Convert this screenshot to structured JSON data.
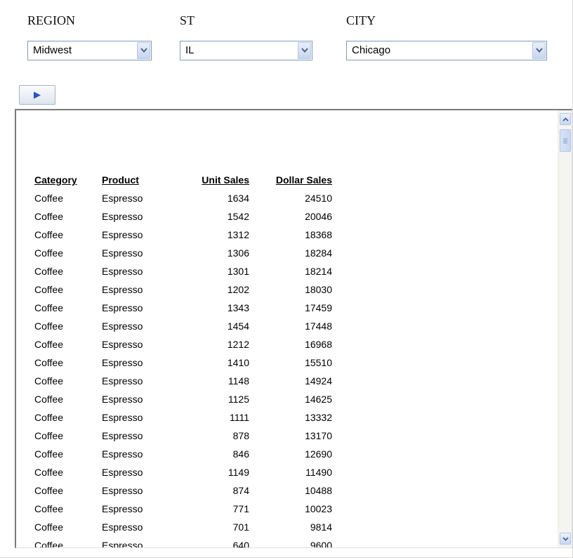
{
  "filters": {
    "region": {
      "label": "REGION",
      "value": "Midwest"
    },
    "state": {
      "label": "ST",
      "value": "IL"
    },
    "city": {
      "label": "CITY",
      "value": "Chicago"
    }
  },
  "run_button": {
    "icon": "play-icon"
  },
  "report": {
    "headers": {
      "category": "Category",
      "product": "Product",
      "unit_sales": "Unit Sales",
      "dollar_sales": "Dollar Sales"
    },
    "rows": [
      {
        "category": "Coffee",
        "product": "Espresso",
        "unit_sales": "1634",
        "dollar_sales": "24510"
      },
      {
        "category": "Coffee",
        "product": "Espresso",
        "unit_sales": "1542",
        "dollar_sales": "20046"
      },
      {
        "category": "Coffee",
        "product": "Espresso",
        "unit_sales": "1312",
        "dollar_sales": "18368"
      },
      {
        "category": "Coffee",
        "product": "Espresso",
        "unit_sales": "1306",
        "dollar_sales": "18284"
      },
      {
        "category": "Coffee",
        "product": "Espresso",
        "unit_sales": "1301",
        "dollar_sales": "18214"
      },
      {
        "category": "Coffee",
        "product": "Espresso",
        "unit_sales": "1202",
        "dollar_sales": "18030"
      },
      {
        "category": "Coffee",
        "product": "Espresso",
        "unit_sales": "1343",
        "dollar_sales": "17459"
      },
      {
        "category": "Coffee",
        "product": "Espresso",
        "unit_sales": "1454",
        "dollar_sales": "17448"
      },
      {
        "category": "Coffee",
        "product": "Espresso",
        "unit_sales": "1212",
        "dollar_sales": "16968"
      },
      {
        "category": "Coffee",
        "product": "Espresso",
        "unit_sales": "1410",
        "dollar_sales": "15510"
      },
      {
        "category": "Coffee",
        "product": "Espresso",
        "unit_sales": "1148",
        "dollar_sales": "14924"
      },
      {
        "category": "Coffee",
        "product": "Espresso",
        "unit_sales": "1125",
        "dollar_sales": "14625"
      },
      {
        "category": "Coffee",
        "product": "Espresso",
        "unit_sales": "1111",
        "dollar_sales": "13332"
      },
      {
        "category": "Coffee",
        "product": "Espresso",
        "unit_sales": "878",
        "dollar_sales": "13170"
      },
      {
        "category": "Coffee",
        "product": "Espresso",
        "unit_sales": "846",
        "dollar_sales": "12690"
      },
      {
        "category": "Coffee",
        "product": "Espresso",
        "unit_sales": "1149",
        "dollar_sales": "11490"
      },
      {
        "category": "Coffee",
        "product": "Espresso",
        "unit_sales": "874",
        "dollar_sales": "10488"
      },
      {
        "category": "Coffee",
        "product": "Espresso",
        "unit_sales": "771",
        "dollar_sales": "10023"
      },
      {
        "category": "Coffee",
        "product": "Espresso",
        "unit_sales": "701",
        "dollar_sales": "9814"
      },
      {
        "category": "Coffee",
        "product": "Espresso",
        "unit_sales": "640",
        "dollar_sales": "9600"
      }
    ]
  },
  "scrollbar": {
    "up_icon": "chevron-up-icon",
    "down_icon": "chevron-down-icon"
  },
  "colors": {
    "accent": "#2554c7",
    "select_border": "#7f9db9",
    "panel_border": "#7a7a7a"
  }
}
